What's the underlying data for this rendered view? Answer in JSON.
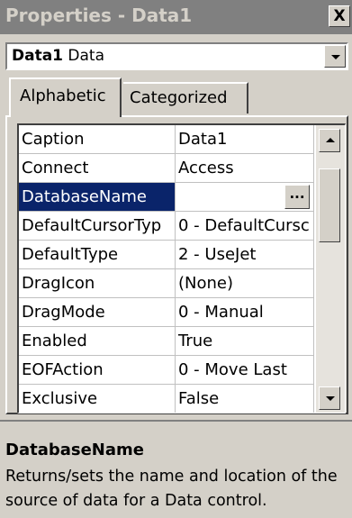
{
  "window": {
    "title": "Properties - Data1",
    "close_label": "X"
  },
  "object_selector": {
    "name": "Data1",
    "type": "Data"
  },
  "tabs": [
    {
      "label": "Alphabetic",
      "active": true
    },
    {
      "label": "Categorized",
      "active": false
    }
  ],
  "properties": [
    {
      "name": "Caption",
      "value": "Data1"
    },
    {
      "name": "Connect",
      "value": "Access"
    },
    {
      "name": "DatabaseName",
      "value": "",
      "selected": true,
      "has_ellipsis": true
    },
    {
      "name": "DefaultCursorTyp",
      "value": "0 - DefaultCursc"
    },
    {
      "name": "DefaultType",
      "value": "2 - UseJet"
    },
    {
      "name": "DragIcon",
      "value": "(None)"
    },
    {
      "name": "DragMode",
      "value": "0 - Manual"
    },
    {
      "name": "Enabled",
      "value": "True"
    },
    {
      "name": "EOFAction",
      "value": "0 - Move Last"
    },
    {
      "name": "Exclusive",
      "value": "False"
    }
  ],
  "ellipsis_label": "...",
  "description": {
    "name": "DatabaseName",
    "text": "Returns/sets the name and location of the source of data for a Data control."
  },
  "colors": {
    "selection": "#0a246a",
    "face": "#d4d0c8",
    "title_inactive": "#808080"
  }
}
